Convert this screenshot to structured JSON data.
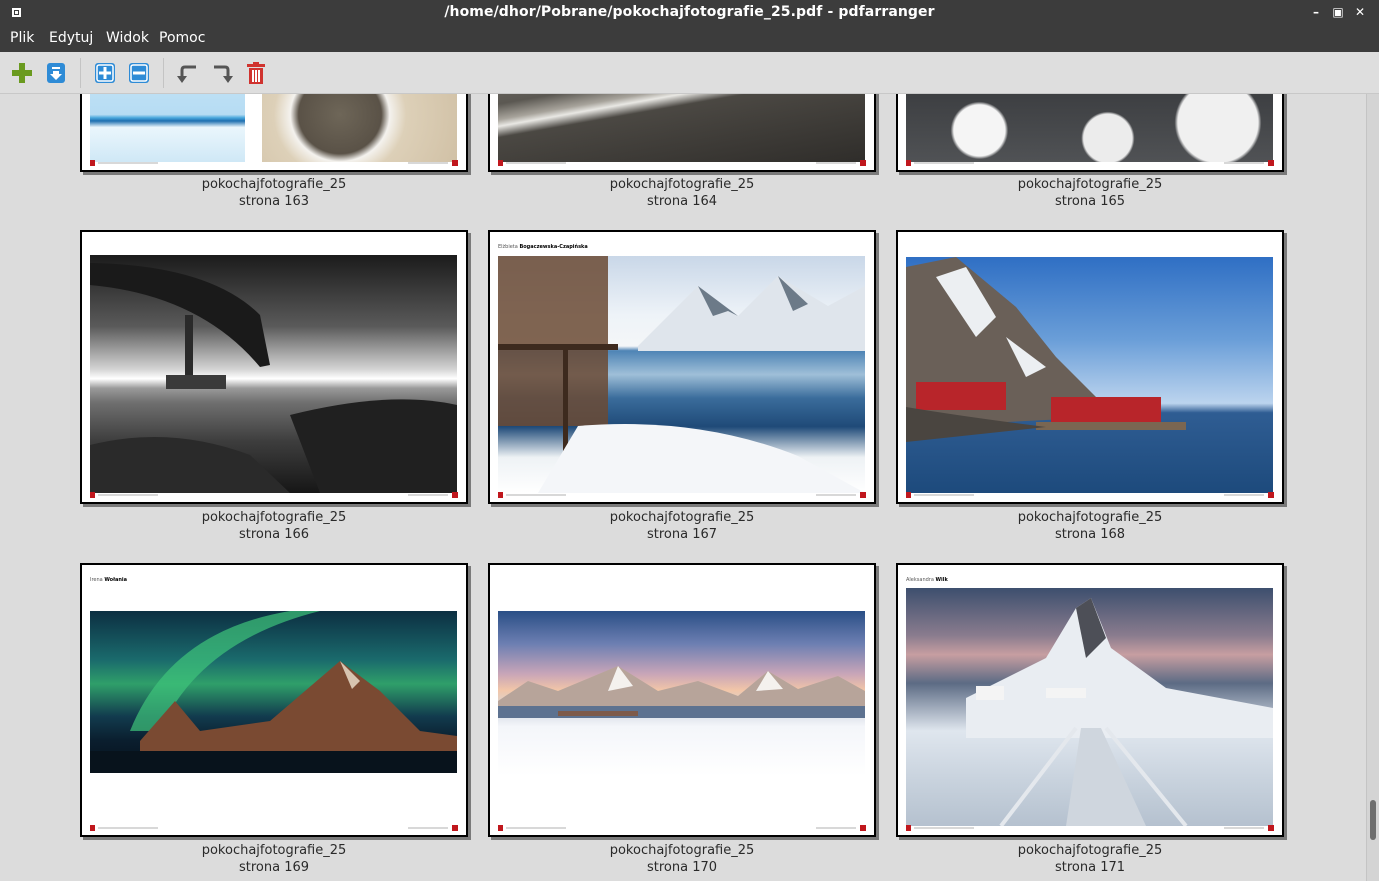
{
  "window": {
    "title": "/home/dhor/Pobrane/pokochajfotografie_25.pdf - pdfarranger"
  },
  "menu": {
    "items": [
      {
        "label": "Plik"
      },
      {
        "label": "Edytuj"
      },
      {
        "label": "Widok"
      },
      {
        "label": "Pomoc"
      }
    ]
  },
  "toolbar": {
    "buttons": [
      "add-icon",
      "export-icon",
      "zoom-in-icon",
      "zoom-out-icon",
      "rotate-left-icon",
      "rotate-right-icon",
      "delete-icon"
    ],
    "colors": {
      "add": "#6a9a1f",
      "blue": "#2e8bd6",
      "delete": "#d0332f",
      "rotate": "#555555"
    }
  },
  "pages": [
    {
      "name": "pokochajfotografie_25",
      "page": "strona 163"
    },
    {
      "name": "pokochajfotografie_25",
      "page": "strona 164"
    },
    {
      "name": "pokochajfotografie_25",
      "page": "strona 165"
    },
    {
      "name": "pokochajfotografie_25",
      "page": "strona 166"
    },
    {
      "name": "pokochajfotografie_25",
      "page": "strona 167",
      "author_first": "Elżbieta",
      "author_last": "Bogaczewska-Czapińska"
    },
    {
      "name": "pokochajfotografie_25",
      "page": "strona 168"
    },
    {
      "name": "pokochajfotografie_25",
      "page": "strona 169",
      "author_first": "Irena",
      "author_last": "Wołania"
    },
    {
      "name": "pokochajfotografie_25",
      "page": "strona 170"
    },
    {
      "name": "pokochajfotografie_25",
      "page": "strona 171",
      "author_first": "Aleksandra",
      "author_last": "Wilk"
    }
  ]
}
